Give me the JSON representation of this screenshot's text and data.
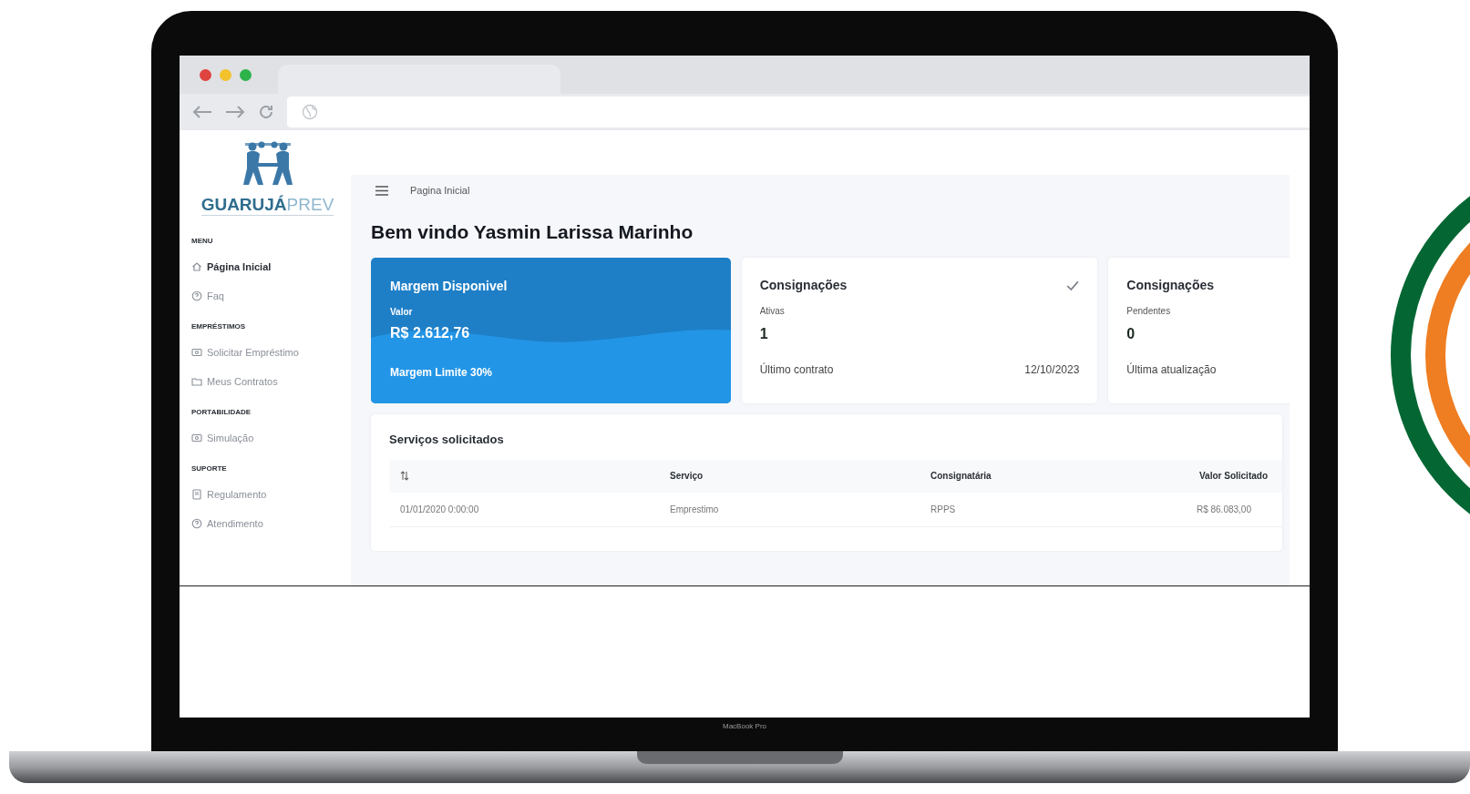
{
  "brand": {
    "name_bold": "GUARUJÁ",
    "name_light": "PREV"
  },
  "sidebar": {
    "sections": [
      {
        "heading": "MENU",
        "items": [
          {
            "label": "Página Inicial",
            "kind": "home",
            "selected": true
          },
          {
            "label": "Faq",
            "kind": "help",
            "selected": false
          }
        ]
      },
      {
        "heading": "EMPRÉSTIMOS",
        "items": [
          {
            "label": "Solicitar Empréstimo",
            "kind": "card",
            "selected": false
          },
          {
            "label": "Meus Contratos",
            "kind": "folder",
            "selected": false
          }
        ]
      },
      {
        "heading": "PORTABILIDADE",
        "items": [
          {
            "label": "Simulação",
            "kind": "card",
            "selected": false
          }
        ]
      },
      {
        "heading": "SUPORTE",
        "items": [
          {
            "label": "Regulamento",
            "kind": "book",
            "selected": false
          },
          {
            "label": "Atendimento",
            "kind": "help",
            "selected": false
          }
        ]
      }
    ]
  },
  "breadcrumb": "Pagina Inicial",
  "welcome": "Bem vindo Yasmin Larissa Marinho",
  "margin_card": {
    "title": "Margem Disponivel",
    "value_label": "Valor",
    "value": "R$ 2.612,76",
    "footer": "Margem Limite 30%"
  },
  "stat_cards": [
    {
      "title": "Consignações",
      "subtitle": "Ativas",
      "value": "1",
      "footer_label": "Último contrato",
      "footer_value": "12/10/2023",
      "checked": true
    },
    {
      "title": "Consignações",
      "subtitle": "Pendentes",
      "value": "0",
      "footer_label": "Última atualização",
      "checked": false
    }
  ],
  "services": {
    "title": "Serviços solicitados",
    "columns": [
      {
        "kind": "sort"
      },
      {
        "kind": "text",
        "label": "Serviço"
      },
      {
        "kind": "text",
        "label": "Consignatária"
      },
      {
        "kind": "text",
        "label": "Valor Solicitado"
      }
    ],
    "rows": [
      [
        "01/01/2020 0:00:00",
        "Emprestimo",
        "RPPS",
        "R$ 86.083,00"
      ]
    ]
  },
  "device_label": "MacBook Pro"
}
